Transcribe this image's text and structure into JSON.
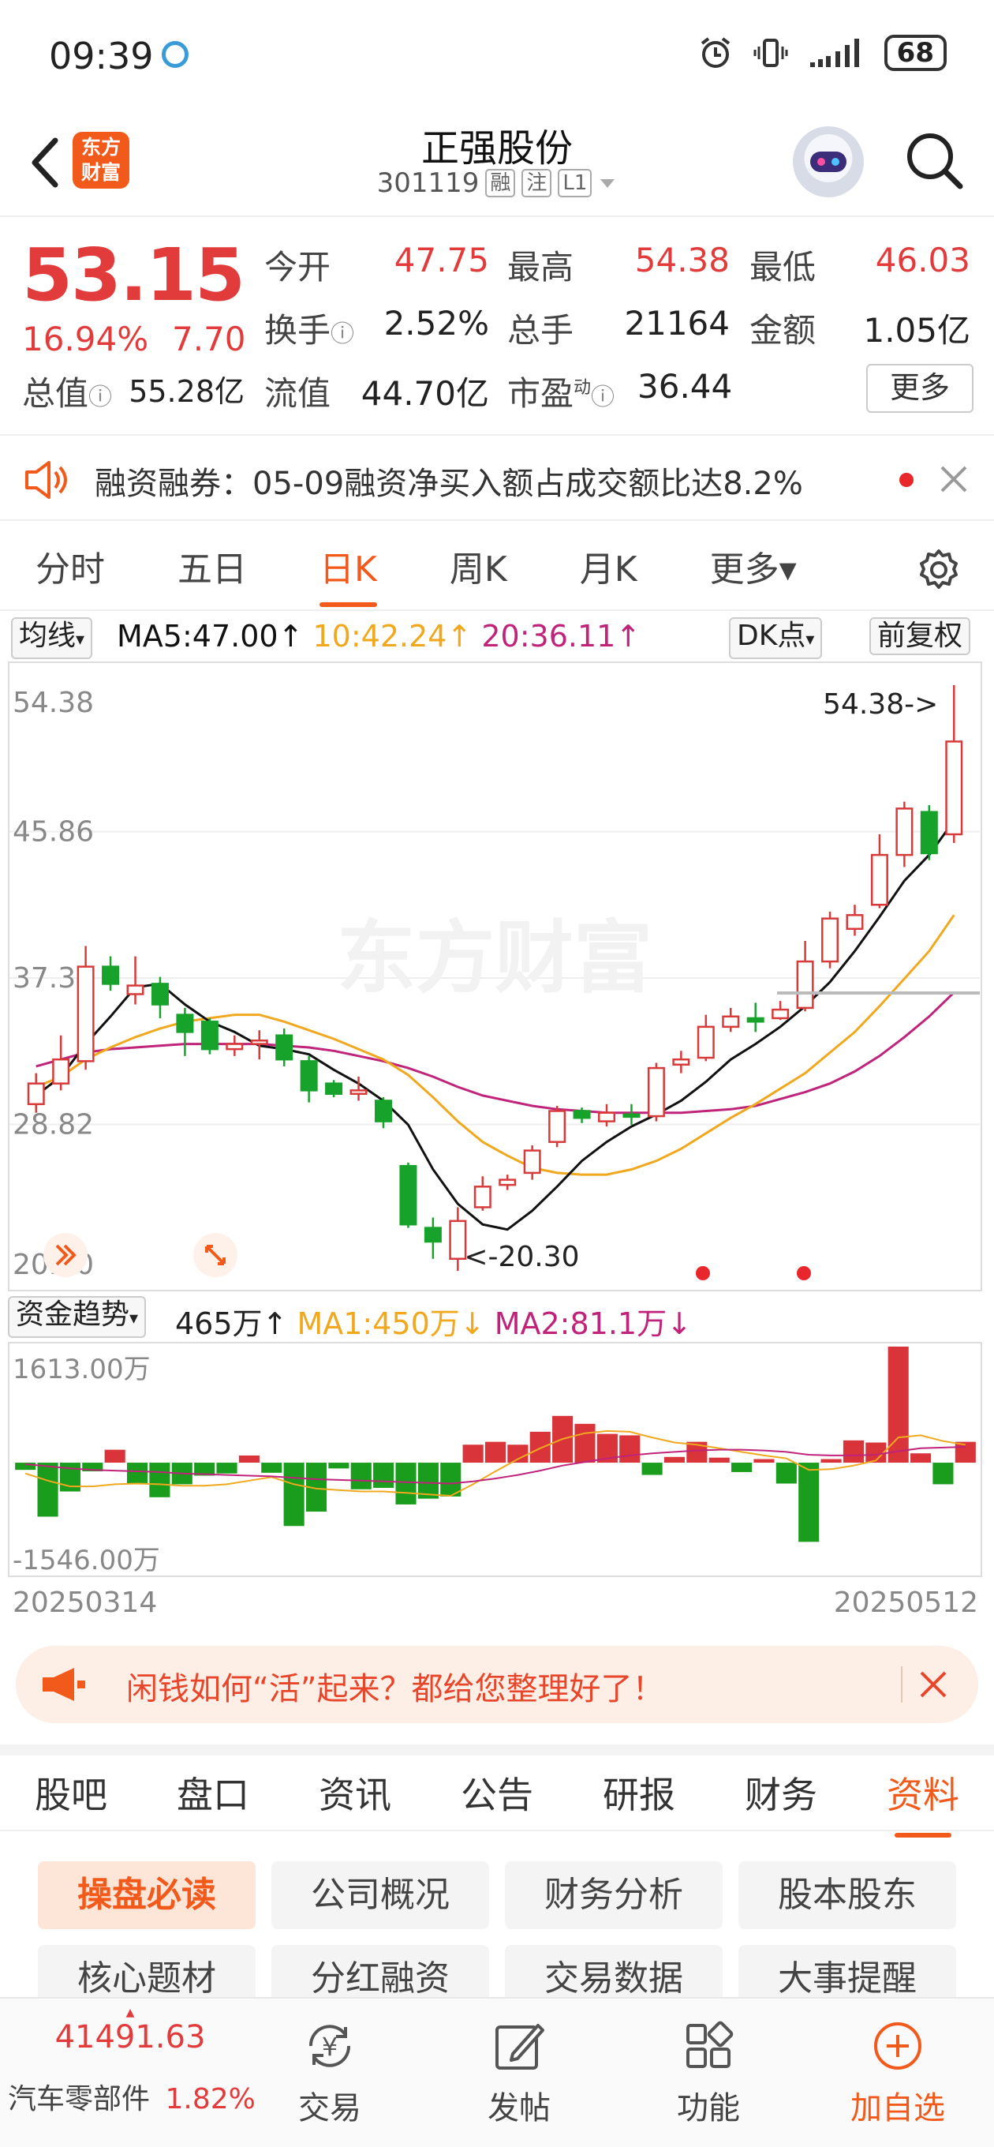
{
  "status_bar": {
    "time": "09:39",
    "battery": "68"
  },
  "header": {
    "brand_line1": "东方",
    "brand_line2": "财富",
    "stock_name": "正强股份",
    "stock_code": "301119",
    "tags": [
      "融",
      "注",
      "L1"
    ]
  },
  "quote": {
    "price": "53.15",
    "change_pct": "16.94%",
    "change_amt": "7.70",
    "fields": [
      {
        "label": "今开",
        "value": "47.75",
        "color": "#e23b3b"
      },
      {
        "label": "最高",
        "value": "54.38",
        "color": "#e23b3b"
      },
      {
        "label": "最低",
        "value": "46.03",
        "color": "#e23b3b"
      },
      {
        "label": "换手",
        "value": "2.52%",
        "color": "#222222"
      },
      {
        "label": "总手",
        "value": "21164",
        "color": "#222222"
      },
      {
        "label": "金额",
        "value": "1.05亿",
        "color": "#222222"
      },
      {
        "label": "总值",
        "value": "55.28亿",
        "color": "#222222"
      },
      {
        "label": "流值",
        "value": "44.70亿",
        "color": "#222222"
      },
      {
        "label": "市盈",
        "value": "36.44",
        "color": "#222222"
      }
    ],
    "pe_superscript": "动",
    "more_label": "更多"
  },
  "ticker": {
    "text": "融资融券：05-09融资净买入额占成交额比达8.2%"
  },
  "chart_tabs": [
    {
      "label": "分时",
      "active": false
    },
    {
      "label": "五日",
      "active": false
    },
    {
      "label": "日K",
      "active": true
    },
    {
      "label": "周K",
      "active": false
    },
    {
      "label": "月K",
      "active": false
    },
    {
      "label": "更多▾",
      "active": false
    }
  ],
  "ma_row": {
    "selector": "均线",
    "ma5": "MA5:47.00↑",
    "ma10": "10:42.24↑",
    "ma20": "20:36.11↑",
    "dk_label": "DK点",
    "adjust_label": "前复权",
    "ma5_color": "#111111",
    "ma10_color": "#f0a81e",
    "ma20_color": "#c0247a"
  },
  "chart_data": [
    {
      "type": "candlestick",
      "y_ticks": [
        "54.38",
        "45.86",
        "37.34",
        "28.82",
        "20.30"
      ],
      "ylim": [
        20.3,
        54.38
      ],
      "max_label": "54.38->",
      "min_label": "<-20.30",
      "watermark": "东方财富",
      "candles": [
        {
          "o": 30.0,
          "c": 31.2,
          "h": 31.8,
          "l": 29.5
        },
        {
          "o": 31.2,
          "c": 32.6,
          "h": 34.0,
          "l": 30.8
        },
        {
          "o": 32.5,
          "c": 38.0,
          "h": 39.2,
          "l": 32.0
        },
        {
          "o": 38.0,
          "c": 37.0,
          "h": 38.6,
          "l": 36.6
        },
        {
          "o": 36.4,
          "c": 36.9,
          "h": 38.6,
          "l": 35.8
        },
        {
          "o": 37.0,
          "c": 35.8,
          "h": 37.4,
          "l": 35.0
        },
        {
          "o": 35.2,
          "c": 34.2,
          "h": 35.6,
          "l": 32.8
        },
        {
          "o": 34.8,
          "c": 33.2,
          "h": 35.0,
          "l": 32.9
        },
        {
          "o": 33.2,
          "c": 33.5,
          "h": 34.0,
          "l": 32.8
        },
        {
          "o": 33.5,
          "c": 33.7,
          "h": 34.3,
          "l": 32.6
        },
        {
          "o": 34.0,
          "c": 32.6,
          "h": 34.4,
          "l": 32.2
        },
        {
          "o": 32.5,
          "c": 30.8,
          "h": 32.8,
          "l": 30.1
        },
        {
          "o": 31.2,
          "c": 30.6,
          "h": 31.4,
          "l": 30.4
        },
        {
          "o": 30.6,
          "c": 30.8,
          "h": 31.6,
          "l": 30.2
        },
        {
          "o": 30.2,
          "c": 29.0,
          "h": 30.4,
          "l": 28.6
        },
        {
          "o": 26.4,
          "c": 23.0,
          "h": 26.6,
          "l": 22.8
        },
        {
          "o": 22.8,
          "c": 22.0,
          "h": 23.4,
          "l": 21.0
        },
        {
          "o": 21.0,
          "c": 23.2,
          "h": 24.0,
          "l": 20.3
        },
        {
          "o": 24.0,
          "c": 25.2,
          "h": 25.8,
          "l": 23.8
        },
        {
          "o": 25.3,
          "c": 25.6,
          "h": 25.9,
          "l": 25.0
        },
        {
          "o": 26.0,
          "c": 27.3,
          "h": 27.6,
          "l": 25.6
        },
        {
          "o": 27.8,
          "c": 29.6,
          "h": 29.9,
          "l": 27.5
        },
        {
          "o": 29.6,
          "c": 29.2,
          "h": 29.8,
          "l": 28.9
        },
        {
          "o": 29.0,
          "c": 29.5,
          "h": 30.0,
          "l": 28.7
        },
        {
          "o": 29.4,
          "c": 29.3,
          "h": 30.0,
          "l": 28.8
        },
        {
          "o": 29.3,
          "c": 32.1,
          "h": 32.4,
          "l": 29.0
        },
        {
          "o": 32.3,
          "c": 32.6,
          "h": 33.1,
          "l": 31.8
        },
        {
          "o": 32.7,
          "c": 34.5,
          "h": 35.2,
          "l": 32.5
        },
        {
          "o": 34.5,
          "c": 35.1,
          "h": 35.6,
          "l": 34.2
        },
        {
          "o": 35.0,
          "c": 34.8,
          "h": 35.9,
          "l": 34.2
        },
        {
          "o": 35.0,
          "c": 35.5,
          "h": 36.0,
          "l": 34.9
        },
        {
          "o": 35.6,
          "c": 38.3,
          "h": 39.5,
          "l": 35.4
        },
        {
          "o": 38.3,
          "c": 40.8,
          "h": 41.2,
          "l": 37.9
        },
        {
          "o": 40.2,
          "c": 41.0,
          "h": 41.6,
          "l": 39.8
        },
        {
          "o": 41.6,
          "c": 44.5,
          "h": 45.7,
          "l": 41.4
        },
        {
          "o": 44.5,
          "c": 47.2,
          "h": 47.6,
          "l": 43.8
        },
        {
          "o": 47.0,
          "c": 44.6,
          "h": 47.4,
          "l": 44.2
        },
        {
          "o": 45.7,
          "c": 51.1,
          "h": 54.38,
          "l": 45.2
        }
      ],
      "ma5": [
        30.5,
        31.6,
        33.5,
        35.1,
        36.8,
        37.0,
        35.8,
        34.8,
        34.2,
        33.4,
        33.2,
        32.9,
        32.0,
        31.2,
        30.2,
        28.8,
        26.2,
        24.2,
        23.0,
        22.7,
        23.8,
        25.2,
        26.7,
        27.8,
        28.7,
        29.4,
        30.2,
        31.3,
        32.6,
        33.5,
        34.5,
        35.7,
        37.1,
        38.9,
        40.9,
        43.0,
        44.5,
        46.5
      ],
      "ma10": [
        31.0,
        31.6,
        32.6,
        33.3,
        33.9,
        34.4,
        34.8,
        35.0,
        35.2,
        35.2,
        34.8,
        34.3,
        33.8,
        33.2,
        32.6,
        31.7,
        30.4,
        29.0,
        27.8,
        27.0,
        26.3,
        26.0,
        25.9,
        25.9,
        26.2,
        26.7,
        27.4,
        28.3,
        29.2,
        30.0,
        30.9,
        31.8,
        33.0,
        34.2,
        35.7,
        37.3,
        38.9,
        41.0
      ],
      "ma20": [
        32.2,
        32.6,
        33.0,
        33.2,
        33.3,
        33.4,
        33.5,
        33.5,
        33.5,
        33.5,
        33.4,
        33.3,
        33.1,
        32.8,
        32.5,
        32.1,
        31.6,
        31.0,
        30.5,
        30.2,
        29.9,
        29.7,
        29.6,
        29.5,
        29.5,
        29.5,
        29.5,
        29.6,
        29.7,
        29.9,
        30.3,
        30.7,
        31.2,
        31.9,
        32.8,
        33.9,
        35.1,
        36.5
      ]
    },
    {
      "type": "bar",
      "title": "资金趋势",
      "y_ticks": [
        "1613.00万",
        "-1546.00万"
      ],
      "ylim": [
        -1546,
        1613
      ],
      "x_labels": [
        "20250314",
        "20250512"
      ],
      "values": [
        -100,
        -750,
        -400,
        -120,
        180,
        -300,
        -480,
        -300,
        -180,
        -150,
        100,
        -140,
        -880,
        -680,
        -80,
        -370,
        -350,
        -580,
        -500,
        -470,
        250,
        290,
        250,
        430,
        650,
        540,
        400,
        380,
        -170,
        80,
        290,
        70,
        -130,
        50,
        -290,
        -1100,
        50,
        310,
        280,
        1613,
        130,
        -300,
        290
      ],
      "ma1": [
        -150,
        -250,
        -330,
        -330,
        -300,
        -290,
        -300,
        -320,
        -320,
        -300,
        -250,
        -200,
        -300,
        -360,
        -380,
        -400,
        -400,
        -420,
        -440,
        -460,
        -300,
        -120,
        50,
        200,
        330,
        410,
        440,
        430,
        350,
        280,
        250,
        200,
        150,
        100,
        60,
        -100,
        -90,
        -40,
        30,
        350,
        380,
        300,
        250
      ],
      "ma2": [
        -20,
        -50,
        -80,
        -100,
        -110,
        -120,
        -130,
        -150,
        -160,
        -170,
        -180,
        -190,
        -210,
        -230,
        -240,
        -250,
        -260,
        -270,
        -280,
        -290,
        -260,
        -220,
        -170,
        -110,
        -40,
        10,
        60,
        100,
        130,
        150,
        170,
        180,
        180,
        170,
        150,
        110,
        100,
        100,
        110,
        160,
        200,
        210,
        220
      ]
    }
  ],
  "fund_row": {
    "selector": "资金趋势",
    "current": "465万↑",
    "ma1": "MA1:450万↓",
    "ma2": "MA2:81.1万↓",
    "ma1_color": "#f0a81e",
    "ma2_color": "#c0247a"
  },
  "promo": {
    "text": "闲钱如何“活”起来？都给您整理好了！"
  },
  "info_tabs": [
    {
      "label": "股吧",
      "active": false
    },
    {
      "label": "盘口",
      "active": false
    },
    {
      "label": "资讯",
      "active": false
    },
    {
      "label": "公告",
      "active": false
    },
    {
      "label": "研报",
      "active": false
    },
    {
      "label": "财务",
      "active": false
    },
    {
      "label": "资料",
      "active": true
    }
  ],
  "sub_tabs": [
    {
      "label": "操盘必读",
      "active": true
    },
    {
      "label": "公司概况",
      "active": false
    },
    {
      "label": "财务分析",
      "active": false
    },
    {
      "label": "股本股东",
      "active": false
    },
    {
      "label": "核心题材",
      "active": false
    },
    {
      "label": "分红融资",
      "active": false
    },
    {
      "label": "交易数据",
      "active": false
    },
    {
      "label": "大事提醒",
      "active": false
    }
  ],
  "bottom_nav": {
    "index_value": "41491.63",
    "index_name": "汽车零部件",
    "index_change": "1.82%",
    "items": [
      {
        "label": "交易",
        "icon": "yuan-exchange-icon"
      },
      {
        "label": "发帖",
        "icon": "compose-icon"
      },
      {
        "label": "功能",
        "icon": "grid-icon"
      },
      {
        "label": "加自选",
        "icon": "add-circle-icon"
      }
    ]
  }
}
